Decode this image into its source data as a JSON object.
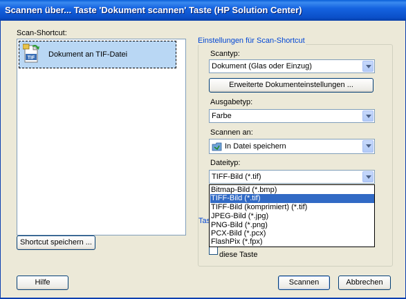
{
  "window": {
    "title": "Scannen über... Taste 'Dokument scannen' Taste (HP Solution Center)"
  },
  "left": {
    "shortcut_label": "Scan-Shortcut:",
    "items": [
      {
        "label": "Dokument an TIF-Datei",
        "icon": "tif-document-icon",
        "icon_text": "TIF"
      }
    ],
    "save_button": "Shortcut speichern ..."
  },
  "settings": {
    "group_title": "Einstellungen für Scan-Shortcut",
    "scantyp_label": "Scantyp:",
    "scantyp_value": "Dokument (Glas oder Einzug)",
    "advanced_button": "Erweiterte Dokumenteinstellungen ...",
    "ausgabetyp_label": "Ausgabetyp:",
    "ausgabetyp_value": "Farbe",
    "scannen_an_label": "Scannen an:",
    "scannen_an_value": "In Datei speichern",
    "dateityp_label": "Dateityp:",
    "dateityp_value": "TIFF-Bild (*.tif)",
    "dateityp_options": [
      "Bitmap-Bild (*.bmp)",
      "TIFF-Bild (*.tif)",
      "TIFF-Bild (komprimiert) (*.tif)",
      "JPEG-Bild (*.jpg)",
      "PNG-Bild (*.png)",
      "PCX-Bild (*.pcx)",
      "FlashPix (*.fpx)"
    ],
    "dateityp_selected_index": 1,
    "hidden_group_fragment": "Tas",
    "checkbox_label_line2": "diese Taste"
  },
  "footer": {
    "help_button": "Hilfe",
    "scan_button": "Scannen",
    "cancel_button": "Abbrechen"
  },
  "colors": {
    "titlebar": "#0a5fd8",
    "dialog_bg": "#ece9d8",
    "selection": "#316ac5",
    "list_selection": "#b9d7f4",
    "group_title": "#0046d5"
  }
}
